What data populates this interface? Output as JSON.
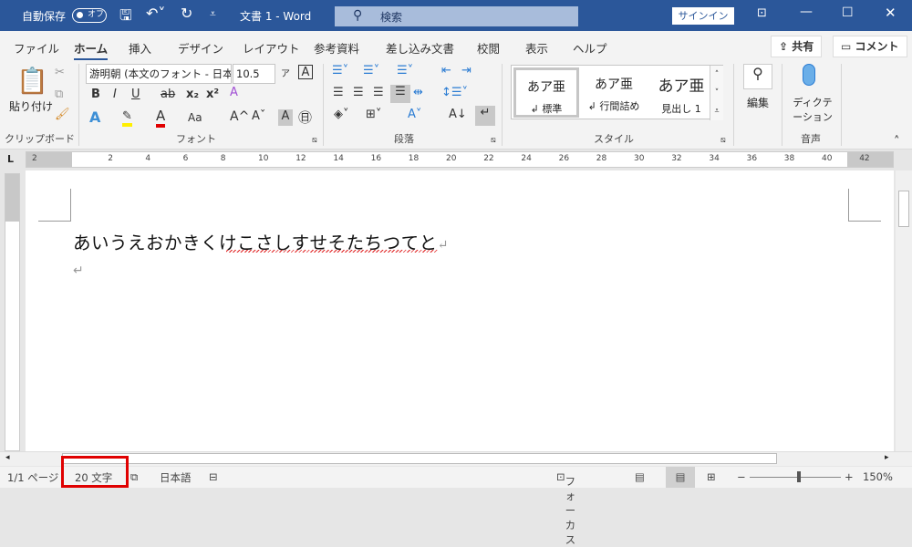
{
  "titlebar": {
    "autosave_label": "自動保存",
    "autosave_state": "オフ",
    "title": "文書 1  -  Word",
    "search_placeholder": "検索",
    "signin": "サインイン",
    "accent": "#2b579a"
  },
  "tabs": [
    "ファイル",
    "ホーム",
    "挿入",
    "デザイン",
    "レイアウト",
    "参考資料",
    "差し込み文書",
    "校閲",
    "表示",
    "ヘルプ"
  ],
  "active_tab": "ホーム",
  "share": "共有",
  "comment": "コメント",
  "ribbon": {
    "clipboard": {
      "paste": "貼り付け",
      "label": "クリップボード"
    },
    "font": {
      "name": "游明朝 (本文のフォント - 日本",
      "size": "10.5",
      "label": "フォント",
      "bold": "B",
      "italic": "I",
      "underline": "U",
      "strike": "ab",
      "sub": "x₂",
      "sup": "x²",
      "case": "Aa",
      "grow": "A^",
      "shrink": "Aˇ"
    },
    "paragraph": {
      "label": "段落"
    },
    "styles": {
      "label": "スタイル",
      "items": [
        {
          "preview": "あア亜",
          "name": "↲ 標準"
        },
        {
          "preview": "あア亜",
          "name": "↲ 行間詰め"
        },
        {
          "preview": "あア亜",
          "name": "見出し 1"
        }
      ]
    },
    "editing": {
      "label": "編集"
    },
    "voice": {
      "dictate": "ディクテーション",
      "label": "音声"
    }
  },
  "ruler": [
    "2",
    "2",
    "4",
    "6",
    "8",
    "10",
    "12",
    "14",
    "16",
    "18",
    "20",
    "22",
    "24",
    "26",
    "28",
    "30",
    "32",
    "34",
    "36",
    "38",
    "40",
    "42"
  ],
  "document": {
    "text": "あいうえおかきくけこさしすせそたちつてと",
    "para_mark": "↵"
  },
  "status": {
    "page": "1/1 ページ",
    "words": "20 文字",
    "language": "日本語",
    "focus": "フォーカス",
    "zoom": "150%",
    "zoom_minus": "−",
    "zoom_plus": "+"
  }
}
